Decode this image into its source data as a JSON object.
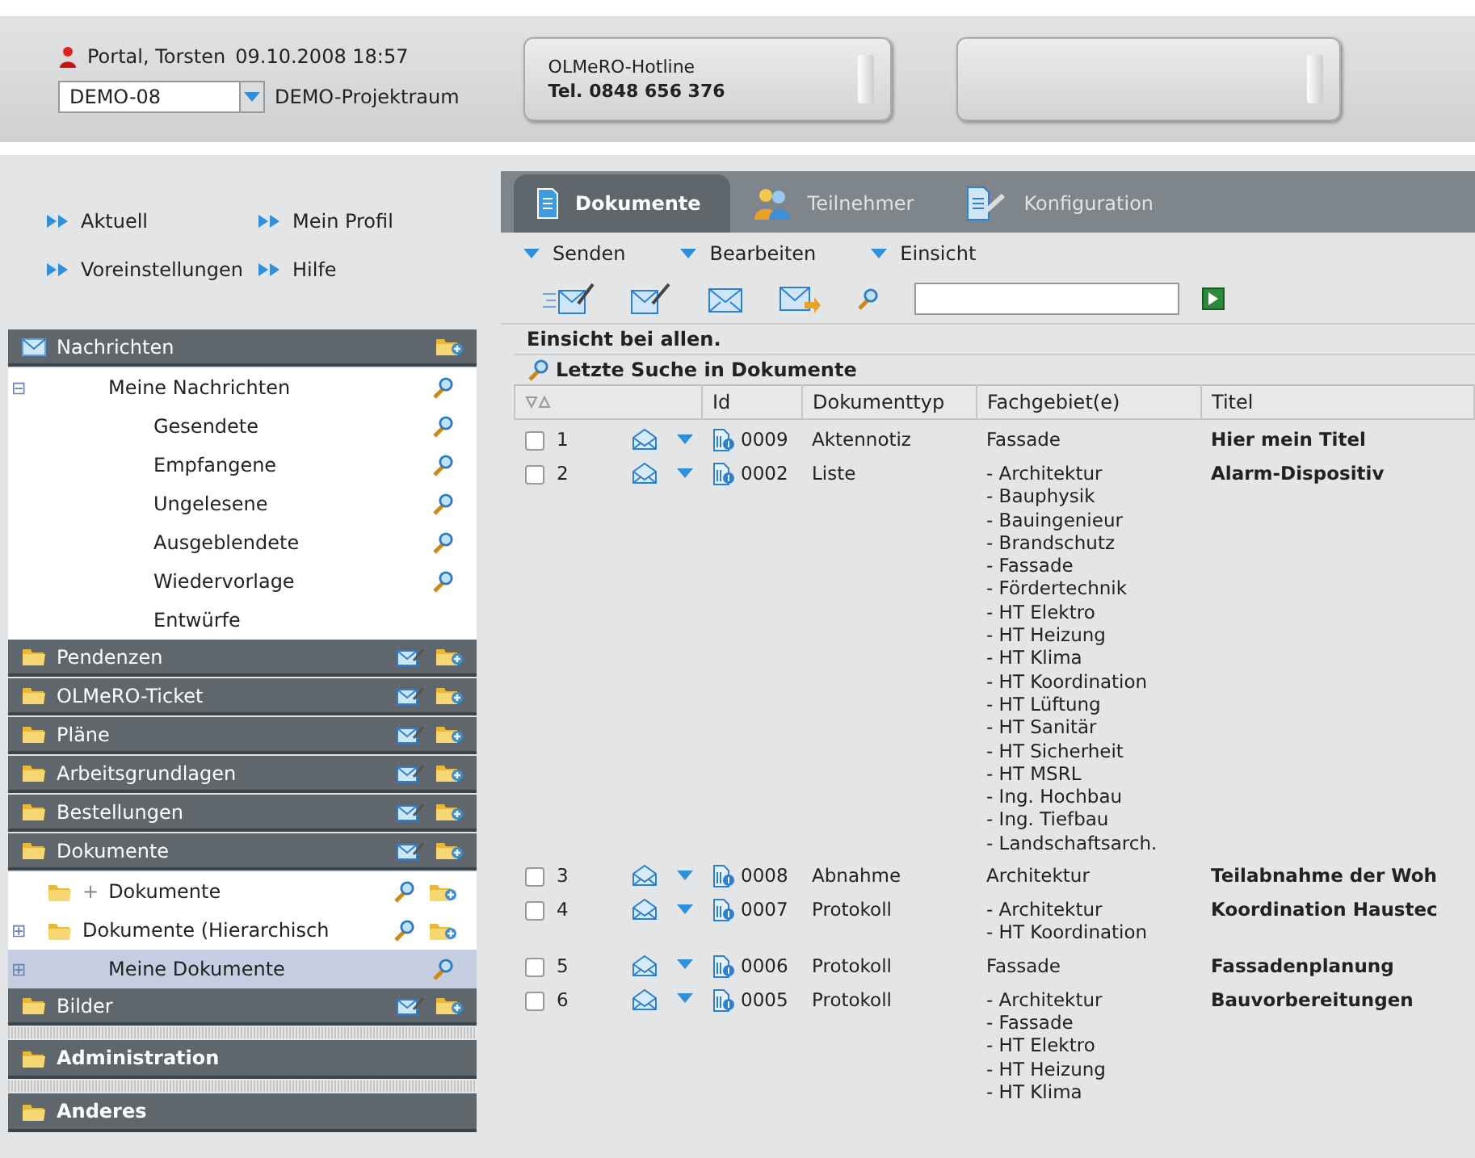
{
  "header": {
    "user": "Portal, Torsten",
    "datetime": "09.10.2008 18:57",
    "project_select": "DEMO-08",
    "project_name": "DEMO-Projektraum",
    "hotline": {
      "label": "OLMeRO-Hotline",
      "phone": "Tel. 0848 656 376"
    }
  },
  "nav_links": [
    "Aktuell",
    "Mein Profil",
    "Voreinstellungen",
    "Hilfe"
  ],
  "sidebar": {
    "sections": [
      {
        "kind": "mail",
        "label": "Nachrichten",
        "items": [
          {
            "label": "Meine Nachrichten",
            "toggle": "⊟",
            "search": true,
            "selected": false,
            "children": [
              {
                "label": "Gesendete",
                "search": true,
                "selected": false
              },
              {
                "label": "Empfangene",
                "search": true,
                "selected": false
              },
              {
                "label": "Ungelesene",
                "search": true,
                "selected": false
              },
              {
                "label": "Ausgeblendete",
                "search": true,
                "selected": false
              },
              {
                "label": "Wiedervorlage",
                "search": true,
                "selected": false
              },
              {
                "label": "Entwürfe",
                "search": false,
                "selected": false
              }
            ]
          }
        ]
      },
      {
        "kind": "folder",
        "label": "Pendenzen"
      },
      {
        "kind": "folder",
        "label": "OLMeRO-Ticket"
      },
      {
        "kind": "folder",
        "label": "Pläne"
      },
      {
        "kind": "folder",
        "label": "Arbeitsgrundlagen"
      },
      {
        "kind": "folder",
        "label": "Bestellungen"
      },
      {
        "kind": "folder",
        "label": "Dokumente",
        "items": [
          {
            "label": "Dokumente",
            "marker": "+",
            "folder": true,
            "search": true,
            "add": true,
            "selected": false
          },
          {
            "label": "Dokumente (Hierarchisch",
            "toggle": "⊞",
            "folder": true,
            "search": true,
            "add": true,
            "selected": false
          },
          {
            "label": "Meine Dokumente",
            "toggle": "⊞",
            "search": true,
            "selected": true
          }
        ]
      },
      {
        "kind": "folder",
        "label": "Bilder"
      },
      {
        "kind": "admin",
        "label": "Administration"
      },
      {
        "kind": "admin",
        "label": "Anderes"
      }
    ]
  },
  "tabs": [
    {
      "label": "Dokumente",
      "kind": "documents",
      "selected": true
    },
    {
      "label": "Teilnehmer",
      "kind": "people",
      "selected": false
    },
    {
      "label": "Konfiguration",
      "kind": "config",
      "selected": false
    }
  ],
  "menus": [
    "Senden",
    "Bearbeiten",
    "Einsicht"
  ],
  "notice": "Einsicht bei allen.",
  "search_title": "Letzte Suche in Dokumente",
  "table": {
    "columns": [
      "Id",
      "Dokumenttyp",
      "Fachgebiet(e)",
      "Titel"
    ],
    "rows": [
      {
        "number": "1",
        "checked": false,
        "id": "0009",
        "type": "Aktennotiz",
        "fields": [
          "Fassade"
        ],
        "title": "Hier mein Titel"
      },
      {
        "number": "2",
        "checked": false,
        "id": "0002",
        "type": "Liste",
        "fields": [
          "- Architektur",
          "- Bauphysik",
          "- Bauingenieur",
          "- Brandschutz",
          "- Fassade",
          "- Fördertechnik",
          "- HT Elektro",
          "- HT Heizung",
          "- HT Klima",
          "- HT Koordination",
          "- HT Lüftung",
          "- HT Sanitär",
          "- HT Sicherheit",
          "- HT MSRL",
          "- Ing. Hochbau",
          "- Ing. Tiefbau",
          "- Landschaftsarch."
        ],
        "title": "Alarm-Dispositiv"
      },
      {
        "number": "3",
        "checked": false,
        "id": "0008",
        "type": "Abnahme",
        "fields": [
          "Architektur"
        ],
        "title": "Teilabnahme der Woh"
      },
      {
        "number": "4",
        "checked": false,
        "id": "0007",
        "type": "Protokoll",
        "fields": [
          "- Architektur",
          "- HT Koordination"
        ],
        "title": "Koordination Haustec"
      },
      {
        "number": "5",
        "checked": false,
        "id": "0006",
        "type": "Protokoll",
        "fields": [
          "Fassade"
        ],
        "title": "Fassadenplanung"
      },
      {
        "number": "6",
        "checked": false,
        "id": "0005",
        "type": "Protokoll",
        "fields": [
          "- Architektur",
          "- Fassade",
          "- HT Elektro",
          "- HT Heizung",
          "- HT Klima"
        ],
        "title": "Bauvorbereitungen"
      }
    ]
  }
}
